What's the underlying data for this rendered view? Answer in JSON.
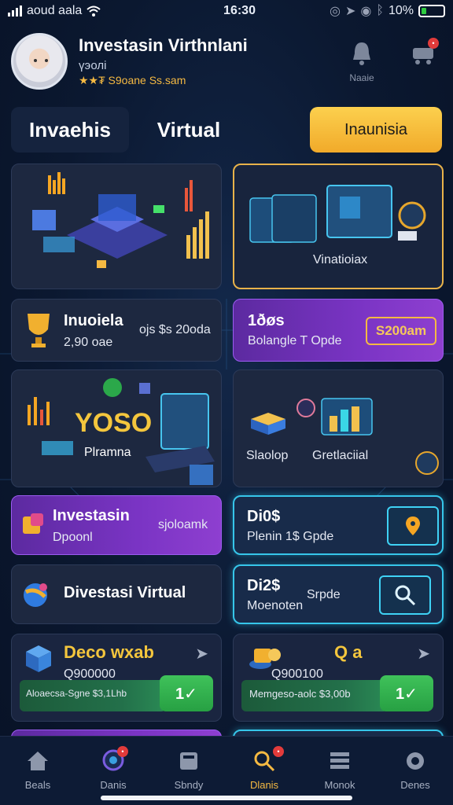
{
  "status_bar": {
    "carrier": "aoud aala",
    "time": "16:30",
    "battery": "10%"
  },
  "header": {
    "name": "Investasin Virthnlani",
    "subtitle": "үэолі",
    "rating": "★★₮ S9oane Ss.sam",
    "icon1_label": "Naaie"
  },
  "tabs": [
    {
      "label": "Invaehis"
    },
    {
      "label": "Virtual"
    },
    {
      "label": "Inaunisia"
    }
  ],
  "cards": {
    "hero_left": {},
    "hero_right": {
      "label": "Vinatioiax"
    },
    "trophy": {
      "title": "Inuoiela",
      "value": "2,90 oae",
      "amount": "ojs $s 20oda"
    },
    "promo": {
      "title": "1ðøs",
      "sub": "Bolangle T Opde",
      "amount": "S200am"
    },
    "yoso": {
      "title": "YOSO",
      "label": "Plramna"
    },
    "stats": {
      "label1": "Slaolop",
      "label2": "Gretlaciial"
    },
    "investasin": {
      "title": "Investasin",
      "sub": "Dpoonl",
      "amount": "sjoloamk"
    },
    "dios": {
      "title": "Di0$",
      "sub": "Plenin 1$ Gpde"
    },
    "divestasi": {
      "title": "Divestasi Virtual"
    },
    "d12": {
      "title": "Di2$",
      "sub": "Moenoten",
      "extra": "Srpde"
    },
    "deco": {
      "title": "Deco wxab",
      "amount": "Q900000",
      "note": "Aloaecsa-Sgne $3,1Lhb",
      "action": "1✓"
    },
    "qa": {
      "title": "Q a",
      "amount": "Q900100",
      "note": "Memgeso-aolc $3,00b",
      "action": "1✓"
    }
  },
  "nav": [
    {
      "label": "Beals",
      "icon": "home-icon"
    },
    {
      "label": "Danis",
      "icon": "chat-icon"
    },
    {
      "label": "Sbndy",
      "icon": "card-icon"
    },
    {
      "label": "Dlanis",
      "icon": "search-icon"
    },
    {
      "label": "Monok",
      "icon": "stack-icon"
    },
    {
      "label": "Denes",
      "icon": "gear-icon"
    }
  ],
  "colors": {
    "accent": "#f5b942",
    "purple": "#7a34c4",
    "cyan": "#36c6ea",
    "green": "#2fb24f"
  }
}
